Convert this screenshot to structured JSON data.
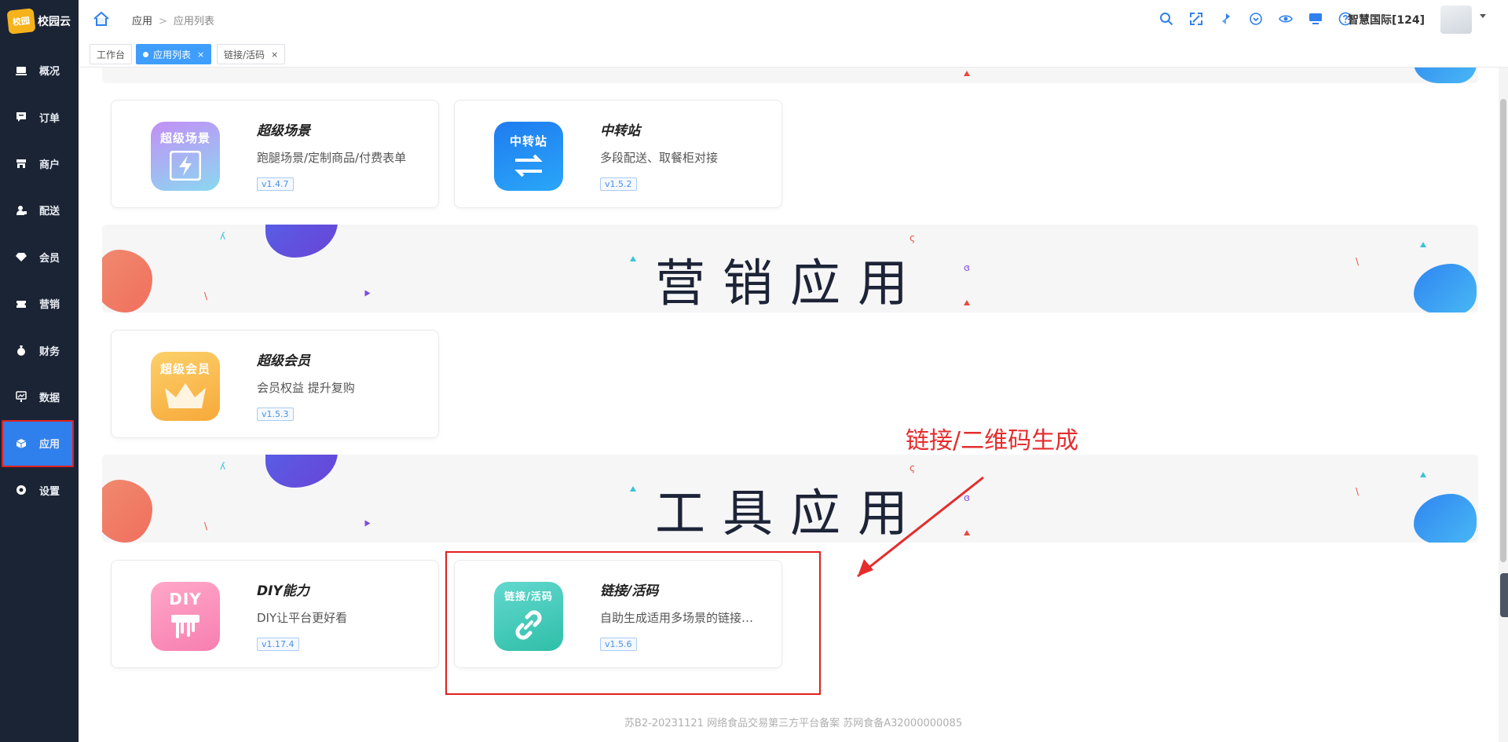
{
  "app": {
    "logo_badge": "校园",
    "logo_text": "校园云"
  },
  "sidebar": {
    "items": [
      {
        "label": "概况",
        "icon": "monitor-icon"
      },
      {
        "label": "订单",
        "icon": "order-icon"
      },
      {
        "label": "商户",
        "icon": "shop-icon"
      },
      {
        "label": "配送",
        "icon": "delivery-icon"
      },
      {
        "label": "会员",
        "icon": "diamond-icon"
      },
      {
        "label": "营销",
        "icon": "ticket-icon"
      },
      {
        "label": "财务",
        "icon": "money-bag-icon"
      },
      {
        "label": "数据",
        "icon": "chart-screen-icon"
      },
      {
        "label": "应用",
        "icon": "cube-icon",
        "active": true
      },
      {
        "label": "设置",
        "icon": "gear-icon"
      }
    ]
  },
  "header": {
    "breadcrumb": {
      "root": "应用",
      "current": "应用列表"
    },
    "user": "智慧国际[124]",
    "icons": [
      "search-icon",
      "fullscreen-icon",
      "refresh-icon",
      "download-icon",
      "eye-icon",
      "screen-icon",
      "help-icon"
    ]
  },
  "tabs": [
    {
      "label": "工作台",
      "active": false,
      "closable": false
    },
    {
      "label": "应用列表",
      "active": true,
      "closable": true
    },
    {
      "label": "链接/活码",
      "active": false,
      "closable": true
    }
  ],
  "sections": {
    "marketing": "营销应用",
    "tools": "工具应用"
  },
  "cards": {
    "super_scene": {
      "icon_label": "超级场景",
      "title": "超级场景",
      "desc": "跑腿场景/定制商品/付费表单",
      "version": "v1.4.7"
    },
    "transfer": {
      "icon_label": "中转站",
      "title": "中转站",
      "desc": "多段配送、取餐柜对接",
      "version": "v1.5.2"
    },
    "super_member": {
      "icon_label": "超级会员",
      "title": "超级会员",
      "desc": "会员权益 提升复购",
      "version": "v1.5.3"
    },
    "diy": {
      "icon_label": "DIY",
      "title": "DIY能力",
      "desc": "DIY让平台更好看",
      "version": "v1.17.4"
    },
    "link_code": {
      "icon_label": "链接/活码",
      "title": "链接/活码",
      "desc": "自助生成适用多场景的链接和活码",
      "version": "v1.5.6"
    }
  },
  "annotation": "链接/二维码生成",
  "footer": "苏B2-20231121   网络食品交易第三方平台备案 苏网食备A32000000085",
  "colors": {
    "sidebar_bg": "#1b2435",
    "accent": "#2f80ed",
    "highlight_red": "#e02020"
  }
}
